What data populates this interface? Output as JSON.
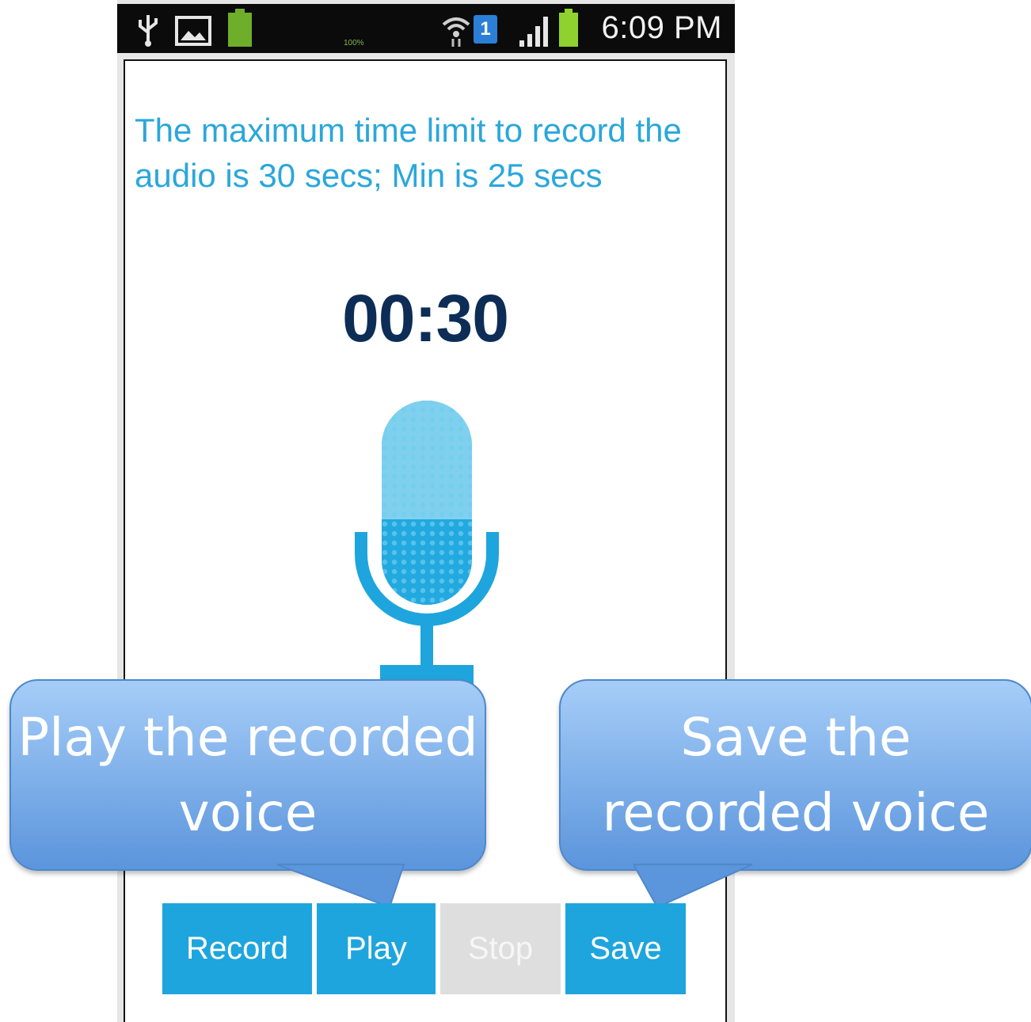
{
  "status_bar": {
    "time": "6:09 PM",
    "battery_percent": "100%",
    "sim_badge": "1",
    "icons": [
      "usb-icon",
      "image-icon",
      "battery-icon",
      "wifi-icon",
      "sim-icon",
      "signal-icon",
      "battery-icon"
    ]
  },
  "info": {
    "text": "The maximum time limit to record the audio is 30 secs; Min is 25 secs"
  },
  "timer": {
    "value": "00:30"
  },
  "mic": {
    "icon": "microphone-icon",
    "color": "#1ea5dd"
  },
  "buttons": {
    "record": "Record",
    "play": "Play",
    "stop": "Stop",
    "save": "Save"
  },
  "callouts": {
    "play": "Play the recorded voice",
    "save": "Save the recorded voice"
  },
  "colors": {
    "accent": "#1ea5dd",
    "timer": "#0d2d57",
    "disabled": "#dedede",
    "callout": "#6fa5e6"
  }
}
